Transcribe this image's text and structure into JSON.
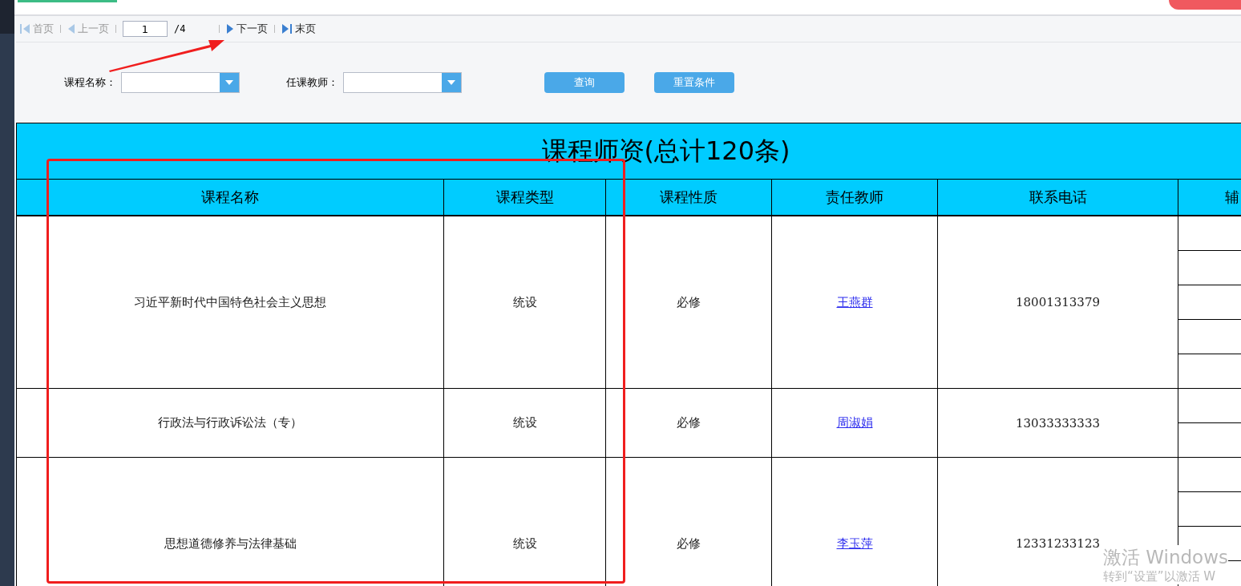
{
  "pager": {
    "items": [
      {
        "kind": "first",
        "label": "首页",
        "disabled": true
      },
      {
        "kind": "prev",
        "label": "上一页",
        "disabled": true
      },
      {
        "kind": "input",
        "value": "1"
      },
      {
        "kind": "total",
        "label": "/4"
      },
      {
        "kind": "next",
        "label": "下一页",
        "disabled": false
      },
      {
        "kind": "last",
        "label": "末页",
        "disabled": false
      }
    ]
  },
  "filters": [
    {
      "label": "课程名称："
    },
    {
      "label": "任课教师："
    }
  ],
  "buttons": [
    "查询",
    "重置条件"
  ],
  "table": {
    "title": "课程师资(总计120条)",
    "columns": [
      "课程名称",
      "课程类型",
      "课程性质",
      "责任教师",
      "联系电话",
      "辅"
    ],
    "rows": [
      {
        "course_name": "习近平新时代中国特色社会主义思想",
        "course_type": "统设",
        "nature": "必修",
        "teacher": "王燕群",
        "phone": "18001313379"
      },
      {
        "course_name": "行政法与行政诉讼法（专）",
        "course_type": "统设",
        "nature": "必修",
        "teacher": "周淑娟",
        "phone": "13033333333"
      },
      {
        "course_name": "思想道德修养与法律基础",
        "course_type": "统设",
        "nature": "必修",
        "teacher": "李玉萍",
        "phone": "12331233123"
      }
    ]
  },
  "activation_notice": {
    "title": "激活 Windows",
    "subtitle": "转到“设置”以激活 W"
  }
}
